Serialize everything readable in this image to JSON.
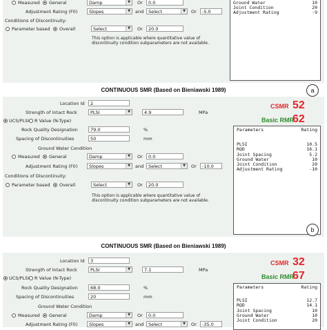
{
  "labels": {
    "location_id": "Location Id",
    "strength": "Strength of Intact Rock",
    "mpa": "MPa",
    "ucs": "UCS/PLSI",
    "r_value": "R Value (N-Type)",
    "rqd": "Rock Quality Designation",
    "pct": "%",
    "spacing": "Spacing of Discontinuities",
    "mm": "mm",
    "gw_condition": "Ground Water Condition",
    "measured": "Measured",
    "general": "General",
    "adjustment": "Adjustment Rating (F0)",
    "and": "and",
    "or": "Or",
    "conditions": "Conditions of Discontinuity:",
    "param_based": "Parameter based",
    "overall": "Overall",
    "note": "This option is applicable where quantitative value of discontinuity condition subparameters are not available.",
    "csmr": "CSMR",
    "basic_rmr": "Basic RMR",
    "out_parameters": "Parameters",
    "out_rating": "Rating"
  },
  "title": "CONTINUOUS SMR (Based on Bieniawski 1989)",
  "panel_a": {
    "badge": "a",
    "gw_select": "Damp",
    "gw_or_value": "0.0",
    "adj_select1": "Slopes",
    "adj_select2": "Select",
    "adj_or_value": "-5.0",
    "cond_select": "Select",
    "cond_or_value": "20.0",
    "output_rows": [
      {
        "name": "Ground Water",
        "value": "10"
      },
      {
        "name": "Joint Condition",
        "value": "20"
      },
      {
        "name": "Adjustment Rating",
        "value": "-9"
      }
    ]
  },
  "panel_b": {
    "badge": "b",
    "location_id": "2",
    "strength_select": "PLSI",
    "strength_value": "4.9",
    "rqd": "79.0",
    "spacing": "50",
    "gw_select": "Damp",
    "gw_or_value": "0.0",
    "adj_select1": "Slopes",
    "adj_select2": "Select",
    "adj_or_value": "-10.0",
    "cond_select": "Select",
    "cond_or_value": "20.0",
    "csmr": "52",
    "basic_rmr": "62",
    "output_rows": [
      {
        "name": "PLSI",
        "value": "10.5"
      },
      {
        "name": "RQD",
        "value": "16.1"
      },
      {
        "name": "Joint Spacing",
        "value": "5.2"
      },
      {
        "name": "Ground Water",
        "value": "10"
      },
      {
        "name": "Joint Condition",
        "value": "20"
      },
      {
        "name": "Adjustment Rating",
        "value": "-10"
      }
    ]
  },
  "panel_c": {
    "location_id": "3",
    "strength_select": "PLSI",
    "strength_value": "7.1",
    "rqd": "68.0",
    "spacing": "20",
    "gw_select": "Damp",
    "gw_or_value": "0.0",
    "adj_select1": "Slopes",
    "adj_select2": "Select",
    "adj_or_value": "-35.0",
    "csmr": "32",
    "basic_rmr": "67",
    "output_rows": [
      {
        "name": "PLSI",
        "value": "12.7"
      },
      {
        "name": "RQD",
        "value": "14.1"
      },
      {
        "name": "Joint Spacing",
        "value": "10"
      },
      {
        "name": "Ground Water",
        "value": "10"
      },
      {
        "name": "Joint Condition",
        "value": "20"
      }
    ]
  },
  "colors": {
    "csmr": "#e0262b",
    "rmr": "#2e8b2e",
    "panel_bg": "#eef2ee"
  }
}
